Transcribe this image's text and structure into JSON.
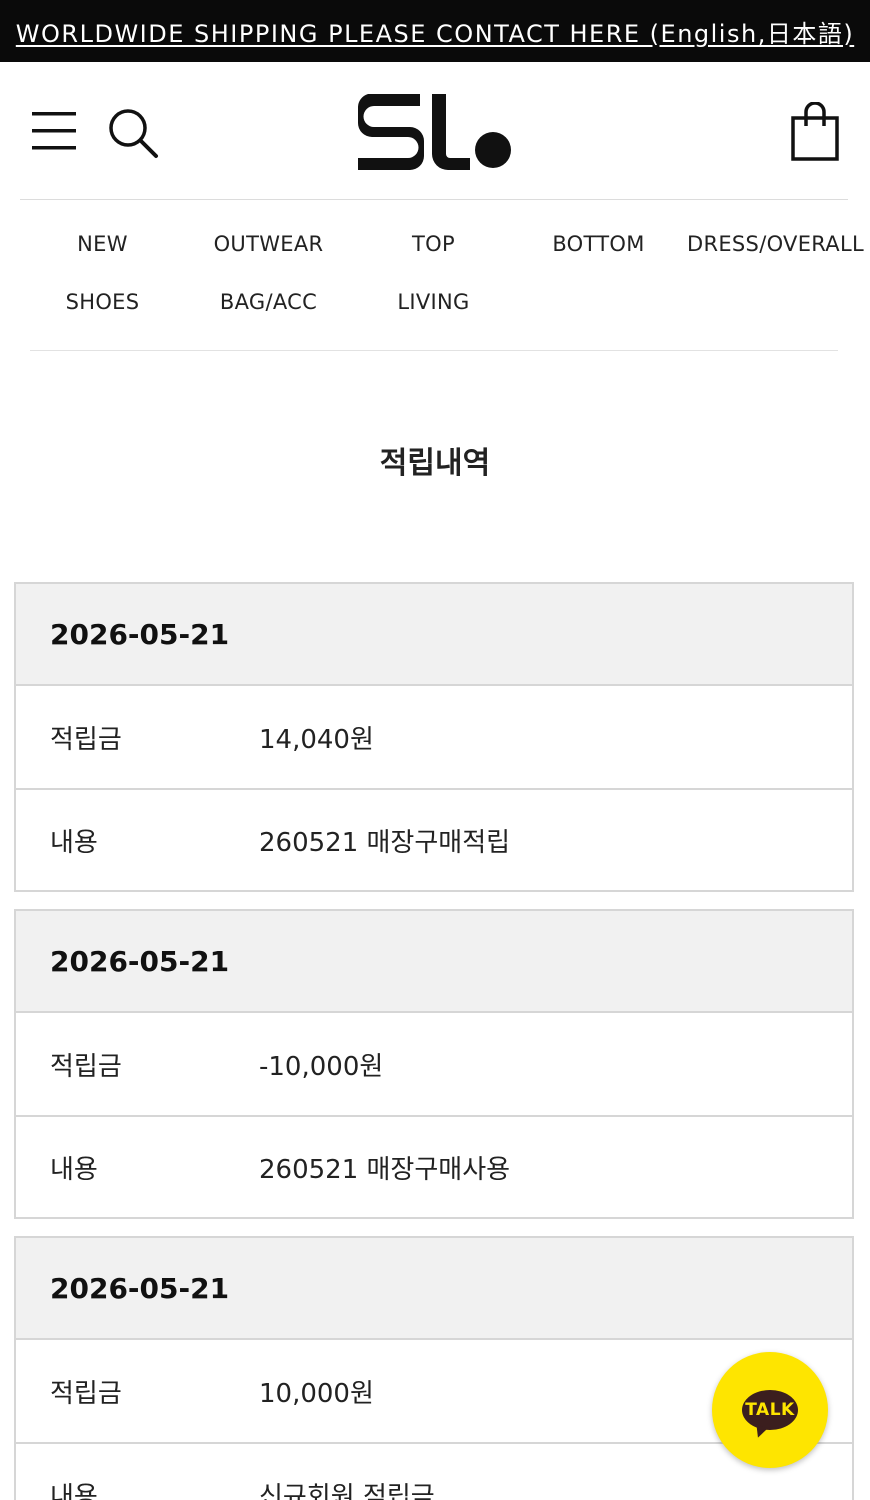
{
  "banner": {
    "text": "WORLDWIDE SHIPPING PLEASE CONTACT HERE (English,日本語)"
  },
  "header": {
    "icons": {
      "menu": "menu-icon",
      "search": "search-icon",
      "logo": "sl-logo",
      "cart": "shopping-bag-icon"
    }
  },
  "nav": {
    "items": [
      "NEW",
      "OUTWEAR",
      "TOP",
      "BOTTOM",
      "DRESS/OVERALL",
      "SHOES",
      "BAG/ACC",
      "LIVING"
    ]
  },
  "page": {
    "title": "적립내역"
  },
  "records": [
    {
      "date": "2026-05-21",
      "amount_label": "적립금",
      "amount": "14,040원",
      "desc_label": "내용",
      "desc": "260521 매장구매적립"
    },
    {
      "date": "2026-05-21",
      "amount_label": "적립금",
      "amount": "-10,000원",
      "desc_label": "내용",
      "desc": "260521 매장구매사용"
    },
    {
      "date": "2026-05-21",
      "amount_label": "적립금",
      "amount": "10,000원",
      "desc_label": "내용",
      "desc": "신규회원 적립금"
    }
  ],
  "talk": {
    "label": "TALK",
    "color": "#fee500"
  }
}
